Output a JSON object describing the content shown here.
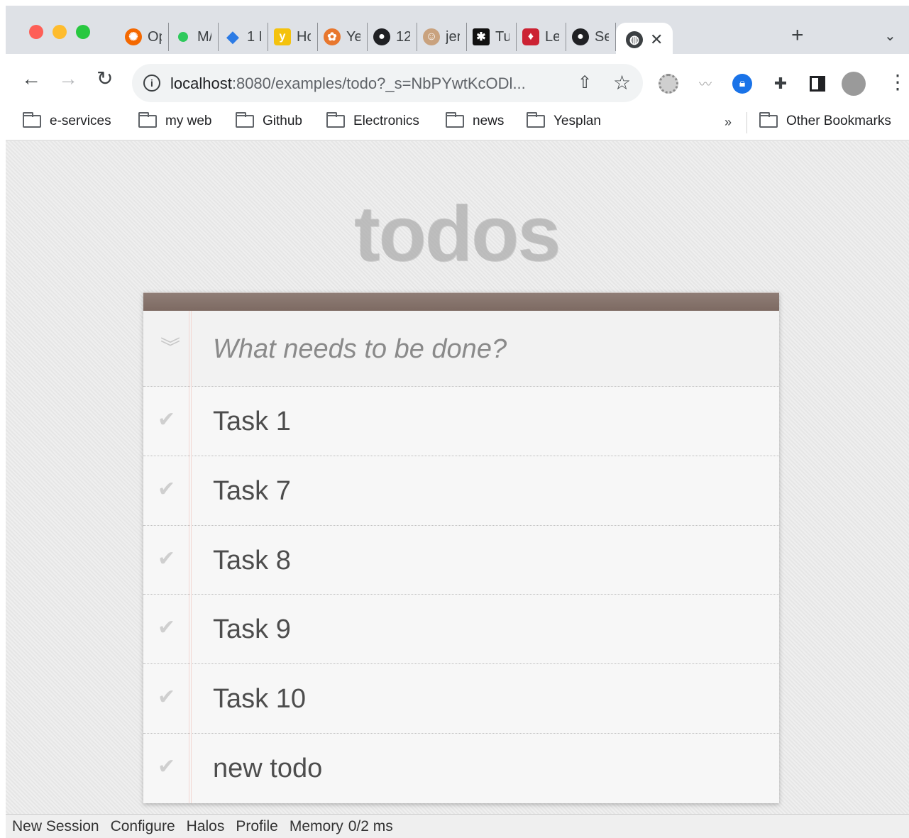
{
  "browser": {
    "tabs": [
      {
        "label": "Op",
        "icon": "grafana-icon",
        "color": "#f46800"
      },
      {
        "label": "M/",
        "icon": "green-dot-icon",
        "color": "#2ec95c"
      },
      {
        "label": "1 N",
        "icon": "blue-diamond-icon",
        "color": "#2c7be5"
      },
      {
        "label": "Ho",
        "icon": "yellow-box-icon",
        "color": "#f4c20d"
      },
      {
        "label": "Ye",
        "icon": "yesplan-icon",
        "color": "#e8772e"
      },
      {
        "label": "12",
        "icon": "github-icon",
        "color": "#202124"
      },
      {
        "label": "jer",
        "icon": "jenkins-icon",
        "color": "#c9a27e"
      },
      {
        "label": "Tu",
        "icon": "tutorial-icon",
        "color": "#111111"
      },
      {
        "label": "Le",
        "icon": "ruby-icon",
        "color": "#cc2233"
      },
      {
        "label": "Se",
        "icon": "github-icon",
        "color": "#202124"
      }
    ],
    "active_tab_close": "✕",
    "new_tab": "+",
    "tab_menu": "⌄",
    "url_host": "localhost",
    "url_rest": ":8080/examples/todo?_s=NbPYwtKcODl...",
    "bookmarks": [
      "e-services",
      "my web",
      "Github",
      "Electronics",
      "news",
      "Yesplan"
    ],
    "bookmarks_more": "»",
    "other_bookmarks": "Other Bookmarks"
  },
  "app": {
    "title": "todos",
    "new_todo_placeholder": "What needs to be done?",
    "todos": [
      {
        "label": "Task 1",
        "completed": false
      },
      {
        "label": "Task 7",
        "completed": false
      },
      {
        "label": "Task 8",
        "completed": false
      },
      {
        "label": "Task 9",
        "completed": false
      },
      {
        "label": "Task 10",
        "completed": false
      },
      {
        "label": "new todo",
        "completed": false
      }
    ]
  },
  "statusbar": {
    "new_session": "New Session",
    "configure": "Configure",
    "halos": "Halos",
    "profile": "Profile",
    "memory": "Memory",
    "timing": "0/2 ms"
  }
}
